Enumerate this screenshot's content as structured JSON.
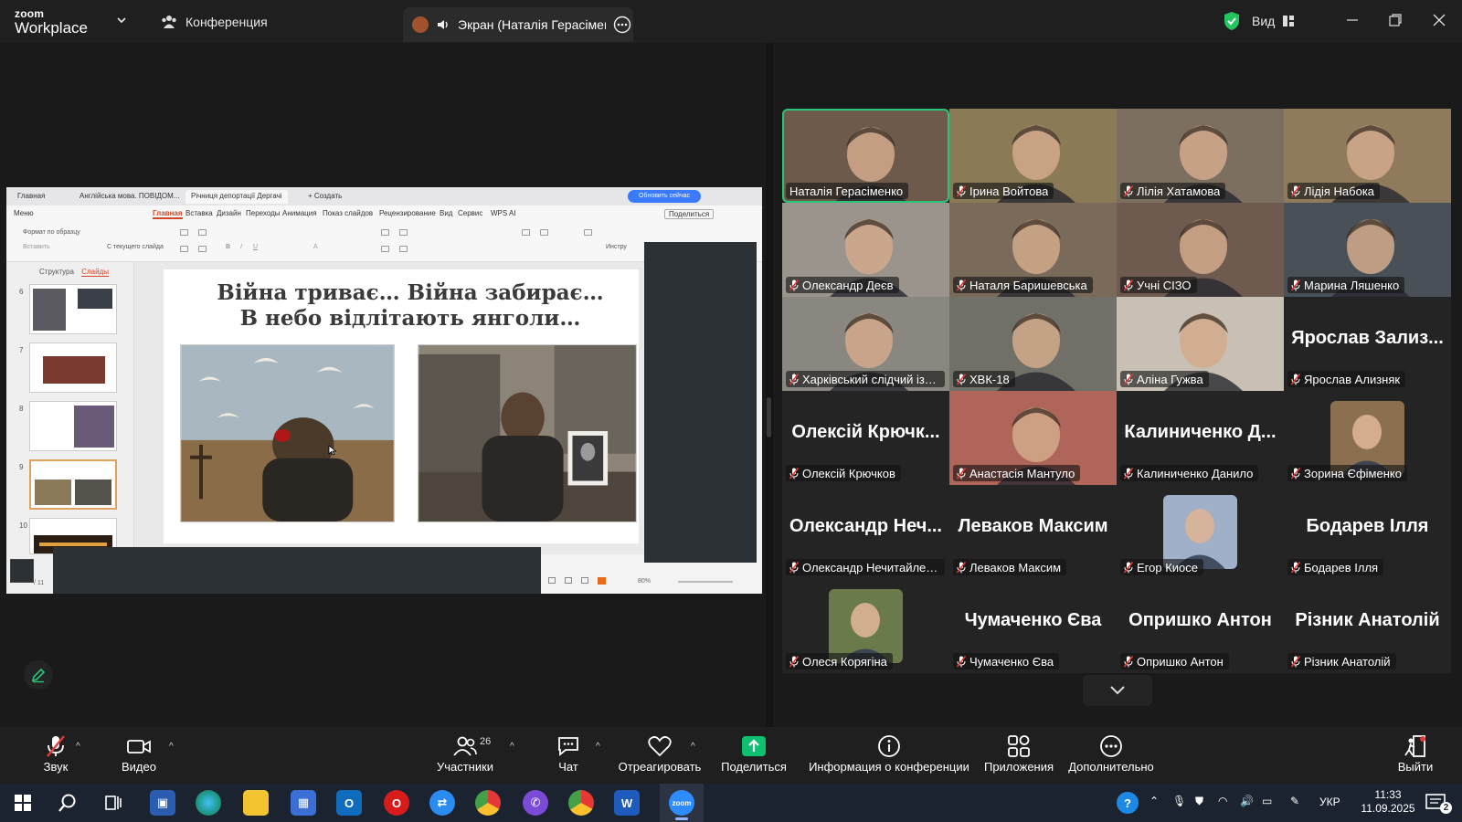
{
  "app": {
    "logo_line1": "zoom",
    "logo_line2": "Workplace",
    "meeting_label": "Конференция",
    "screen_tab_label": "Экран (Наталія Герасіменко",
    "view_label": "Вид",
    "security_color": "#22c55e"
  },
  "shared_screen": {
    "wps_tabs": [
      "Главная",
      "Англійська мова. ПОВІДОМ...",
      "Річниця депортації Дергачі",
      "+ Создать"
    ],
    "update_button": "Обновить сейчас",
    "menu": [
      "Меню",
      "Главная",
      "Вставка",
      "Дизайн",
      "Переходы",
      "Анимация",
      "Показ слайдов",
      "Рецензирование",
      "Вид",
      "Сервис",
      "WPS AI"
    ],
    "share_button": "Поделиться",
    "ribbon": {
      "format_painter": "Формат по образцу",
      "insert": "Вставить",
      "from_current": "С текущего слайда",
      "tool_short": "Инстру"
    },
    "panel_tabs": {
      "structure": "Структура",
      "slides": "Слайды"
    },
    "thumb_numbers": [
      "6",
      "7",
      "8",
      "9",
      "10"
    ],
    "slide_title_line1": "Війна триває… Війна забирає…",
    "slide_title_line2": "В небо відлітають янголи…",
    "page_counter": "/ 11",
    "zoom_level": "80%"
  },
  "gallery": {
    "participants": [
      {
        "name": "Наталія Герасіменко",
        "muted": false,
        "active": true,
        "video": true,
        "bg": "#6e5a4a"
      },
      {
        "name": "Ірина Войтова",
        "muted": true,
        "video": true,
        "bg": "#8a7a55"
      },
      {
        "name": "Лілія Хатамова",
        "muted": true,
        "video": true,
        "bg": "#7d6f60"
      },
      {
        "name": "Лідія Набока",
        "muted": true,
        "video": true,
        "bg": "#8f7a5c"
      },
      {
        "name": "Олександр Деєв",
        "muted": true,
        "video": true,
        "bg": "#9a948c"
      },
      {
        "name": "Наталя Баришевська",
        "muted": true,
        "video": true,
        "bg": "#7a6a5a"
      },
      {
        "name": "Учні СІЗО",
        "muted": true,
        "video": true,
        "bg": "#6f5a4f"
      },
      {
        "name": "Марина Ляшенко",
        "muted": true,
        "video": true,
        "bg": "#4a5058"
      },
      {
        "name": "Харківський слідчий ізол...",
        "muted": true,
        "video": true,
        "bg": "#8a8680"
      },
      {
        "name": "ХВК-18",
        "muted": true,
        "video": true,
        "bg": "#707068"
      },
      {
        "name": "Аліна Гужва",
        "muted": true,
        "video": true,
        "bg": "#c8c0b4"
      },
      {
        "name": "Ярослав Ализняк",
        "muted": true,
        "video": false,
        "big_name": "Ярослав Зализ..."
      },
      {
        "name": "Олексій Крючков",
        "muted": true,
        "video": false,
        "big_name": "Олексій Крючк..."
      },
      {
        "name": "Анастасія Мантуло",
        "muted": true,
        "video": true,
        "bg": "#b0655a"
      },
      {
        "name": "Калиниченко Данило",
        "muted": true,
        "video": false,
        "big_name": "Калиниченко Д..."
      },
      {
        "name": "Зорина Єфіменко",
        "muted": true,
        "video": false,
        "photo": true,
        "bg": "#8a7050"
      },
      {
        "name": "Олександр Нечитайленко",
        "muted": true,
        "video": false,
        "big_name": "Олександр Неч..."
      },
      {
        "name": "Леваков Максим",
        "muted": true,
        "video": false,
        "big_name": "Леваков Максим"
      },
      {
        "name": "Егор Киосе",
        "muted": true,
        "video": false,
        "photo": true,
        "bg": "#9fb0c8"
      },
      {
        "name": "Бодарев Ілля",
        "muted": true,
        "video": false,
        "big_name": "Бодарев Ілля"
      },
      {
        "name": "Олеся Корягіна",
        "muted": true,
        "video": false,
        "photo": true,
        "bg": "#6a7a4a"
      },
      {
        "name": "Чумаченко Єва",
        "muted": true,
        "video": false,
        "big_name": "Чумаченко Єва"
      },
      {
        "name": "Опришко Антон",
        "muted": true,
        "video": false,
        "big_name": "Опришко Антон"
      },
      {
        "name": "Різник Анатолій",
        "muted": true,
        "video": false,
        "big_name": "Різник Анатолій"
      }
    ]
  },
  "toolbar": {
    "audio": "Звук",
    "video": "Видео",
    "participants": "Участники",
    "participants_count": "26",
    "chat": "Чат",
    "react": "Отреагировать",
    "share": "Поделиться",
    "meeting_info": "Информация о конференции",
    "apps": "Приложения",
    "more": "Дополнительно",
    "leave": "Выйти"
  },
  "taskbar": {
    "language": "УКР",
    "time": "11:33",
    "date": "11.09.2025",
    "notification_count": "2"
  }
}
